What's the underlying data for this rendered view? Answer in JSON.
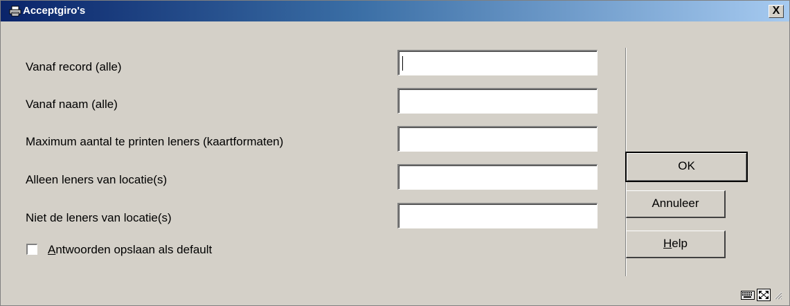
{
  "window": {
    "title": "Acceptgiro's",
    "close_label": "X",
    "title_icon": "printer-icon"
  },
  "form": {
    "fields": [
      {
        "label": "Vanaf record (alle)",
        "value": ""
      },
      {
        "label": "Vanaf naam (alle)",
        "value": ""
      },
      {
        "label": "Maximum aantal te printen leners (kaartformaten)",
        "value": ""
      },
      {
        "label": "Alleen leners van locatie(s)",
        "value": ""
      },
      {
        "label": "Niet de leners van locatie(s)",
        "value": ""
      }
    ],
    "checkbox": {
      "label_rest": "ntwoorden opslaan als default",
      "label_accel": "A",
      "checked": false
    }
  },
  "buttons": {
    "ok": "OK",
    "cancel": "Annuleer",
    "help_accel": "H",
    "help_rest": "elp"
  },
  "status_icons": [
    "keyboard-icon",
    "resize-icon",
    "grip-icon"
  ],
  "colors": {
    "titlebar_start": "#0a246a",
    "titlebar_end": "#a6caf0",
    "window_bg": "#d4d0c8"
  }
}
